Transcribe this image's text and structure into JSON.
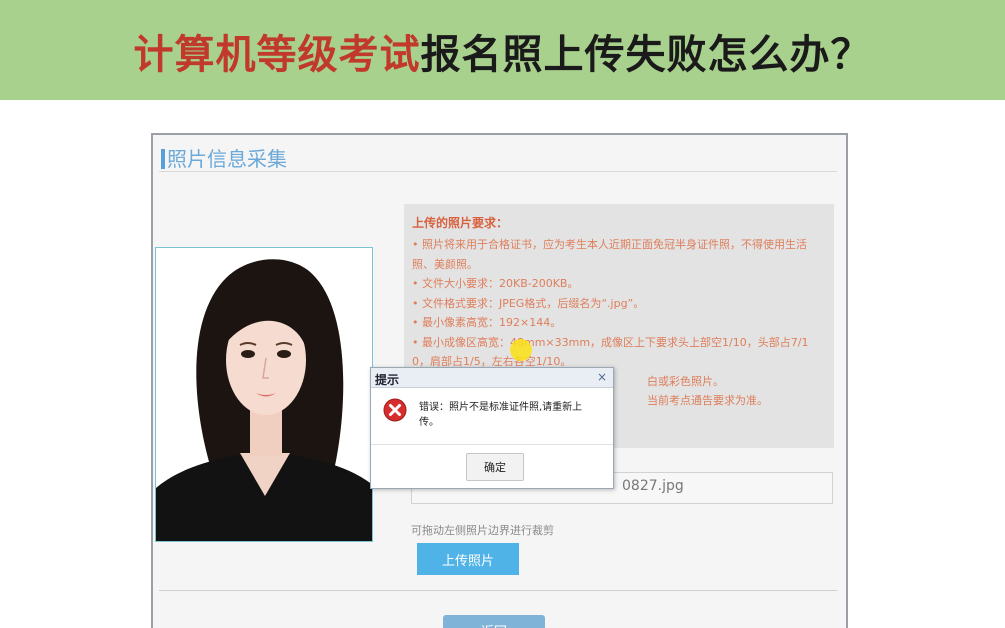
{
  "banner": {
    "title_red": "计算机等级考试",
    "title_dark": "报名照上传失败怎么办？",
    "colors": {
      "background": "#a9d18e",
      "title_red": "#c0392b",
      "title_dark": "#1a1a1a"
    }
  },
  "section": {
    "title": "照片信息采集"
  },
  "requirements": {
    "title": "上传的照片要求：",
    "lines": [
      "• 照片将来用于合格证书，应为考生本人近期正面免冠半身证件照，不得使用生活",
      "照、美颜照。",
      "• 文件大小要求：20KB-200KB。",
      "• 文件格式要求：JPEG格式，后缀名为“.jpg”。",
      "• 最小像素高宽：192×144。",
      "• 最小成像区高宽：48mm×33mm，成像区上下要求头上部空1/10，头部占7/1",
      "0，肩部占1/5，左右各空1/10。",
      "白或彩色照片。",
      "当前考点通告要求为准。"
    ]
  },
  "file_field": {
    "value": "0827.jpg"
  },
  "hint": "可拖动左侧照片边界进行裁剪",
  "upload_button": "上传照片",
  "back_button": "返回",
  "dialog": {
    "title": "提示",
    "close": "×",
    "message": "错误：照片不是标准证件照,请重新上传。",
    "ok": "确定",
    "icon": "error-icon"
  }
}
